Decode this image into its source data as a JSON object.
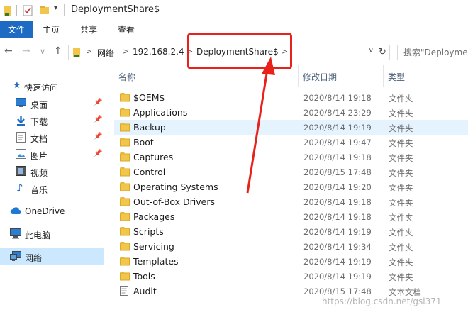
{
  "window": {
    "title": "DeploymentShare$"
  },
  "ribbon": {
    "tabs": [
      "文件",
      "主页",
      "共享",
      "查看"
    ]
  },
  "address": {
    "crumbs": [
      "网络",
      "192.168.2.4",
      "DeploymentShare$"
    ],
    "separator": ">",
    "dropdown": "∨",
    "refresh": "↻"
  },
  "search": {
    "placeholder": "搜索\"DeploymentShare$\""
  },
  "nav": {
    "back": "←",
    "forward": "→",
    "up": "↑"
  },
  "sidebar": {
    "quick_access": "快速访问",
    "pinned": [
      "桌面",
      "下载",
      "文档",
      "图片"
    ],
    "unpinned": [
      "视频",
      "音乐"
    ],
    "onedrive": "OneDrive",
    "this_pc": "此电脑",
    "network": "网络"
  },
  "columns": {
    "name": "名称",
    "date": "修改日期",
    "type": "类型"
  },
  "files": [
    {
      "name": "$OEM$",
      "date": "2020/8/14 19:18",
      "type": "文件夹"
    },
    {
      "name": "Applications",
      "date": "2020/8/14 23:29",
      "type": "文件夹"
    },
    {
      "name": "Backup",
      "date": "2020/8/14 19:19",
      "type": "文件夹"
    },
    {
      "name": "Boot",
      "date": "2020/8/14 19:47",
      "type": "文件夹"
    },
    {
      "name": "Captures",
      "date": "2020/8/14 19:18",
      "type": "文件夹"
    },
    {
      "name": "Control",
      "date": "2020/8/15 17:48",
      "type": "文件夹"
    },
    {
      "name": "Operating Systems",
      "date": "2020/8/14 19:20",
      "type": "文件夹"
    },
    {
      "name": "Out-of-Box Drivers",
      "date": "2020/8/14 19:18",
      "type": "文件夹"
    },
    {
      "name": "Packages",
      "date": "2020/8/14 19:18",
      "type": "文件夹"
    },
    {
      "name": "Scripts",
      "date": "2020/8/14 19:19",
      "type": "文件夹"
    },
    {
      "name": "Servicing",
      "date": "2020/8/14 19:34",
      "type": "文件夹"
    },
    {
      "name": "Templates",
      "date": "2020/8/14 19:19",
      "type": "文件夹"
    },
    {
      "name": "Tools",
      "date": "2020/8/14 19:19",
      "type": "文件夹"
    },
    {
      "name": "Audit",
      "date": "2020/8/15 17:48",
      "type": "文本文档"
    }
  ],
  "watermark": "https://blog.csdn.net/gsl371",
  "colors": {
    "accent": "#1e6bc4",
    "highlight": "#e8221b",
    "folder": "#f2c54b",
    "selection": "#cce8ff"
  }
}
